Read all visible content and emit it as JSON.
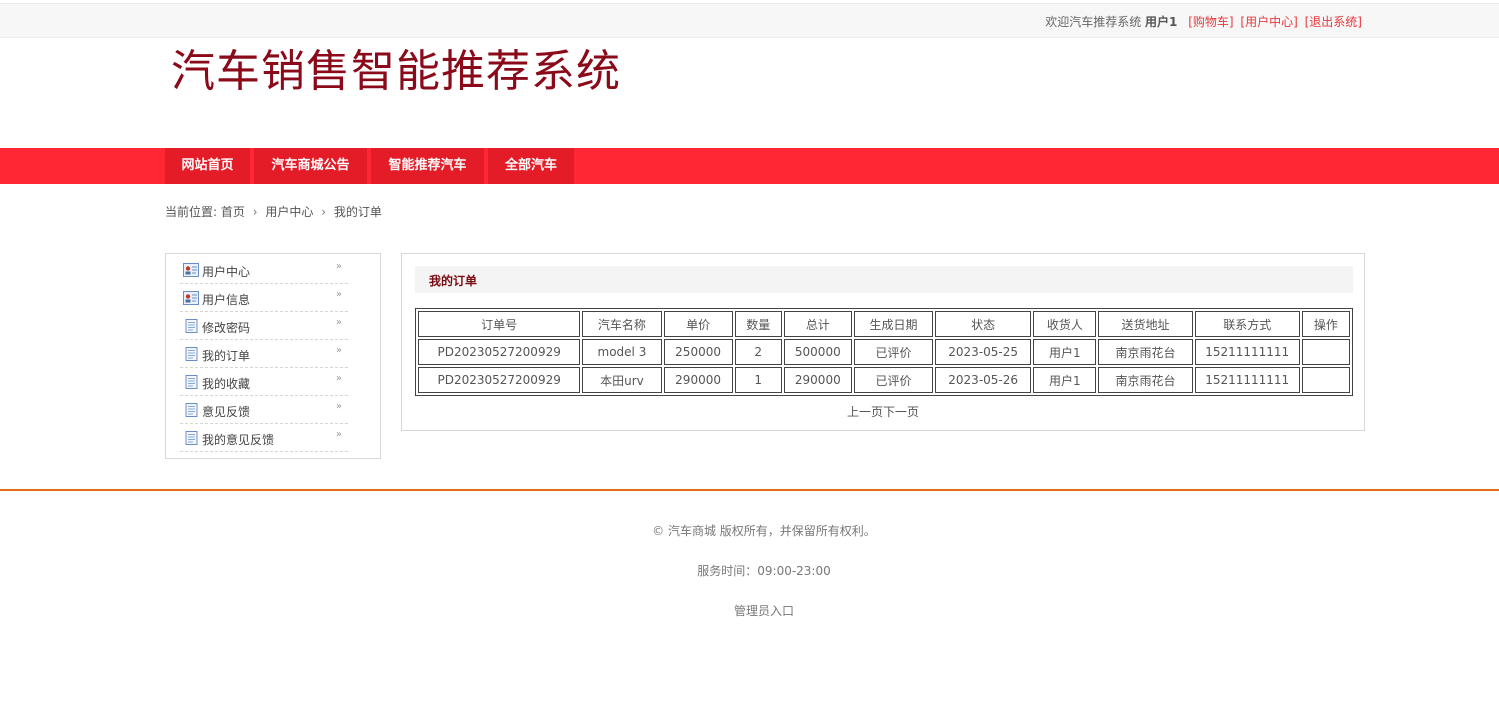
{
  "topbar": {
    "welcome": "欢迎汽车推荐系统",
    "username": "用户1",
    "links": [
      "[购物车]",
      "[用户中心]",
      "[退出系统]"
    ]
  },
  "site": {
    "title": "汽车销售智能推荐系统"
  },
  "nav": [
    "网站首页",
    "汽车商城公告",
    "智能推荐汽车",
    "全部汽车"
  ],
  "breadcrumb": {
    "prefix": "当前位置:",
    "items": [
      "首页",
      "用户中心",
      "我的订单"
    ],
    "separator": "›"
  },
  "sidebar": {
    "items": [
      {
        "label": "用户中心",
        "icon": "id-card-icon"
      },
      {
        "label": "用户信息",
        "icon": "id-card-icon"
      },
      {
        "label": "修改密码",
        "icon": "document-icon"
      },
      {
        "label": "我的订单",
        "icon": "document-icon"
      },
      {
        "label": "我的收藏",
        "icon": "document-icon"
      },
      {
        "label": "意见反馈",
        "icon": "document-icon"
      },
      {
        "label": "我的意见反馈",
        "icon": "document-icon"
      }
    ],
    "arrow": "»"
  },
  "orders": {
    "title": "我的订单",
    "columns": [
      "订单号",
      "汽车名称",
      "单价",
      "数量",
      "总计",
      "生成日期",
      "状态",
      "收货人",
      "送货地址",
      "联系方式",
      "操作"
    ],
    "rows": [
      [
        "PD20230527200929",
        "model 3",
        "250000",
        "2",
        "500000",
        "已评价",
        "2023-05-25",
        "用户1",
        "南京雨花台",
        "15211111111",
        ""
      ],
      [
        "PD20230527200929",
        "本田urv",
        "290000",
        "1",
        "290000",
        "已评价",
        "2023-05-26",
        "用户1",
        "南京雨花台",
        "15211111111",
        ""
      ]
    ],
    "pager": {
      "prev": "上一页",
      "next": "下一页"
    }
  },
  "footer": {
    "copyright": "© 汽车商城 版权所有，并保留所有权利。",
    "service_hours": "服务时间：09:00-23:00",
    "admin_link": "管理员入口"
  },
  "colors": {
    "brand_red": "#ff2733",
    "nav_item": "#e41c28",
    "title_red": "#8b0a1a",
    "footer_line": "#e26b17",
    "link_red": "#e8383d"
  }
}
